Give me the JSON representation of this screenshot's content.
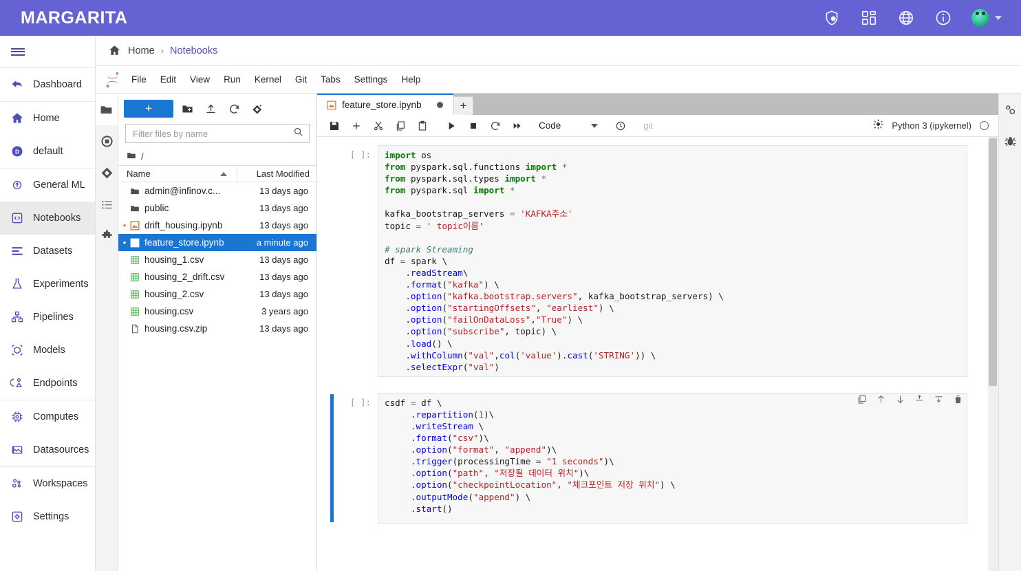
{
  "header": {
    "brand": "MARGARITA",
    "accent_color": "#6563d4",
    "icons": [
      {
        "name": "shield-lock-icon"
      },
      {
        "name": "apps-grid-icon"
      },
      {
        "name": "globe-icon"
      },
      {
        "name": "info-icon"
      }
    ],
    "avatar_label": "",
    "caret_label": ""
  },
  "sidebar": {
    "hamburger_label": "",
    "groups": [
      {
        "items": [
          {
            "label": "Dashboard",
            "icon": "back-arrow-icon",
            "active": false
          }
        ]
      },
      {
        "items": [
          {
            "label": "Home",
            "icon": "home-icon",
            "active": false
          },
          {
            "label": "default",
            "icon": "default-badge-icon",
            "active": false
          }
        ]
      },
      {
        "items": [
          {
            "label": "General ML",
            "icon": "general-ml-icon",
            "active": false
          },
          {
            "label": "Notebooks",
            "icon": "notebook-code-icon",
            "active": true
          },
          {
            "label": "Datasets",
            "icon": "datasets-icon",
            "active": false
          },
          {
            "label": "Experiments",
            "icon": "flask-icon",
            "active": false
          },
          {
            "label": "Pipelines",
            "icon": "pipelines-icon",
            "active": false
          },
          {
            "label": "Models",
            "icon": "models-cube-icon",
            "active": false
          },
          {
            "label": "Endpoints",
            "icon": "endpoints-icon",
            "active": false
          }
        ]
      },
      {
        "items": [
          {
            "label": "Computes",
            "icon": "cpu-chip-icon",
            "active": false
          },
          {
            "label": "Datasources",
            "icon": "datasource-icon",
            "active": false
          }
        ]
      },
      {
        "items": [
          {
            "label": "Workspaces",
            "icon": "workspaces-icon",
            "active": false
          },
          {
            "label": "Settings",
            "icon": "settings-gear-icon",
            "active": false
          }
        ]
      }
    ]
  },
  "breadcrumb": {
    "home": "Home",
    "separator": "›",
    "current": "Notebooks"
  },
  "jupyter_menubar": {
    "items": [
      "File",
      "Edit",
      "View",
      "Run",
      "Kernel",
      "Git",
      "Tabs",
      "Settings",
      "Help"
    ]
  },
  "activity_bar": {
    "items": [
      {
        "name": "file-browser-icon",
        "active": true
      },
      {
        "name": "running-terminals-icon",
        "active": false
      },
      {
        "name": "git-icon",
        "active": false
      },
      {
        "name": "table-of-contents-icon",
        "active": false
      },
      {
        "name": "extension-puzzle-icon",
        "active": false
      }
    ]
  },
  "right_bar": {
    "items": [
      {
        "name": "property-inspector-icon"
      },
      {
        "name": "debugger-bug-icon"
      }
    ]
  },
  "file_browser": {
    "new_button_label": "+",
    "toolbar_buttons": [
      {
        "name": "new-folder-icon"
      },
      {
        "name": "upload-icon"
      },
      {
        "name": "refresh-icon"
      },
      {
        "name": "git-clone-icon"
      }
    ],
    "filter_placeholder": "Filter files by name",
    "filter_value": "",
    "path": "/",
    "columns": {
      "name": "Name",
      "modified": "Last Modified"
    },
    "rows": [
      {
        "name": "admin@infinov.c...",
        "modified": "13 days ago",
        "type": "folder",
        "dot": false,
        "selected": false
      },
      {
        "name": "public",
        "modified": "13 days ago",
        "type": "folder",
        "dot": false,
        "selected": false
      },
      {
        "name": "drift_housing.ipynb",
        "modified": "13 days ago",
        "type": "notebook-running",
        "dot": true,
        "selected": false
      },
      {
        "name": "feature_store.ipynb",
        "modified": "a minute ago",
        "type": "notebook",
        "dot": true,
        "selected": true
      },
      {
        "name": "housing_1.csv",
        "modified": "13 days ago",
        "type": "csv",
        "dot": false,
        "selected": false
      },
      {
        "name": "housing_2_drift.csv",
        "modified": "13 days ago",
        "type": "csv",
        "dot": false,
        "selected": false
      },
      {
        "name": "housing_2.csv",
        "modified": "13 days ago",
        "type": "csv",
        "dot": false,
        "selected": false
      },
      {
        "name": "housing.csv",
        "modified": "3 years ago",
        "type": "csv",
        "dot": false,
        "selected": false
      },
      {
        "name": "housing.csv.zip",
        "modified": "13 days ago",
        "type": "file",
        "dot": false,
        "selected": false
      }
    ]
  },
  "notebook": {
    "tab_label": "feature_store.ipynb",
    "tab_dirty": true,
    "add_tab_label": "+",
    "toolbar_buttons": [
      {
        "name": "save-icon"
      },
      {
        "name": "insert-cell-below-icon"
      },
      {
        "name": "cut-icon"
      },
      {
        "name": "copy-icon"
      },
      {
        "name": "paste-icon"
      },
      {
        "name": "run-cell-icon"
      },
      {
        "name": "stop-kernel-icon"
      },
      {
        "name": "restart-kernel-icon"
      },
      {
        "name": "restart-and-run-all-icon"
      }
    ],
    "cell_type": "Code",
    "history_icon": "clock-icon",
    "git_label": "git",
    "kernel_name": "Python 3 (ipykernel)",
    "kernel_settings_icon": "kernel-gear-icon",
    "kernel_status": "idle",
    "cell_toolbar_buttons": [
      {
        "name": "duplicate-cell-icon"
      },
      {
        "name": "move-cell-up-icon"
      },
      {
        "name": "move-cell-down-icon"
      },
      {
        "name": "insert-cell-above-icon"
      },
      {
        "name": "insert-cell-below-icon"
      },
      {
        "name": "delete-cell-icon"
      }
    ],
    "cells": [
      {
        "prompt": "[ ]:",
        "active": false,
        "source": "import os\nfrom pyspark.sql.functions import *\nfrom pyspark.sql.types import *\nfrom pyspark.sql import *\n\nkafka_bootstrap_servers = 'KAFKA주소'\ntopic = ' topic이름'\n\n# spark Streaming\ndf = spark \\\n    .readStream\\\n    .format(\"kafka\") \\\n    .option(\"kafka.bootstrap.servers\", kafka_bootstrap_servers) \\\n    .option(\"startingOffsets\", \"earliest\") \\\n    .option(\"failOnDataLoss\",\"True\") \\\n    .option(\"subscribe\", topic) \\\n    .load() \\\n    .withColumn(\"val\",col('value').cast('STRING')) \\\n    .selectExpr(\"val\")"
      },
      {
        "prompt": "[ ]:",
        "active": true,
        "source": "csdf = df \\\n     .repartition(1)\\\n     .writeStream \\\n     .format(\"csv\")\\\n     .option(\"format\", \"append\")\\\n     .trigger(processingTime = \"1 seconds\")\\\n     .option(\"path\", \"저장될 데이터 위치\")\\\n     .option(\"checkpointLocation\", \"체크포인트 저장 위치\") \\\n     .outputMode(\"append\") \\\n     .start()"
      }
    ]
  }
}
